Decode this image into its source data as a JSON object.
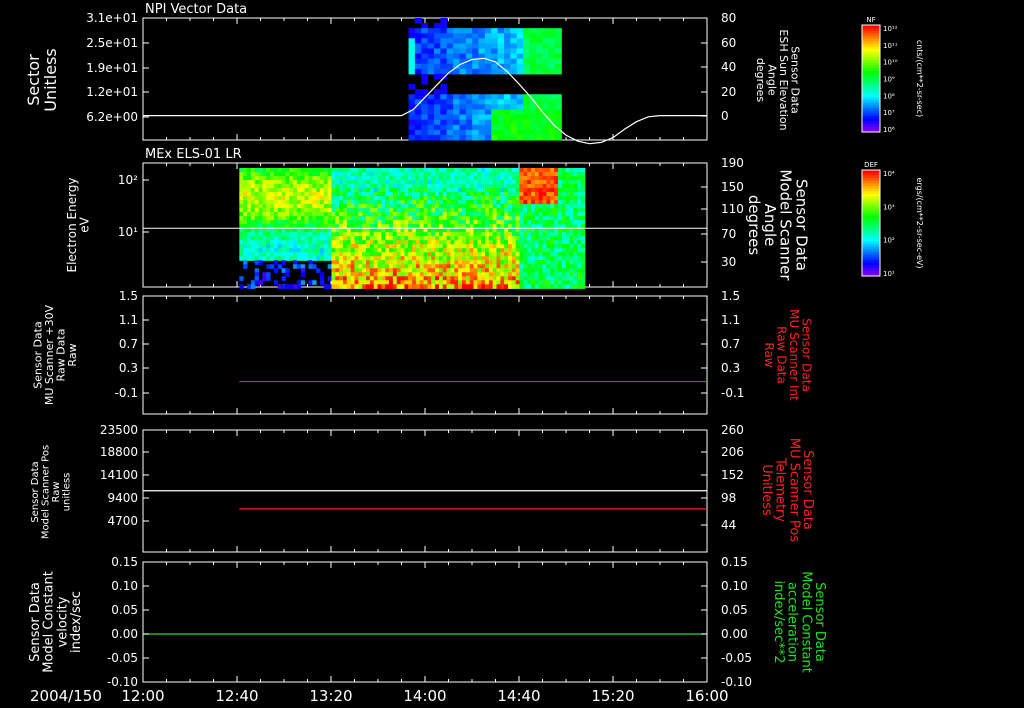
{
  "footer": {
    "date_label": "2004/150"
  },
  "time_axis": {
    "ticks": [
      "12:00",
      "12:40",
      "13:20",
      "14:00",
      "14:40",
      "15:20",
      "16:00"
    ],
    "tick_minutes": [
      0,
      40,
      80,
      120,
      160,
      200,
      240
    ]
  },
  "colorbars": [
    {
      "tag": "NF",
      "unit": "cnts/(cm**2-sr-sec)",
      "labels": [
        "10¹²",
        "10¹¹",
        "10¹⁰",
        "10⁹",
        "10⁸",
        "10⁷",
        "10⁶"
      ]
    },
    {
      "tag": "DEF",
      "unit": "ergs/(cm**2-sr-sec-eV)",
      "labels": [
        "10⁴",
        "10³",
        "10²",
        "10¹"
      ]
    }
  ],
  "chart_data": [
    {
      "type": "heatmap",
      "title": "NPI Vector Data",
      "ylabel": [
        "Sector",
        "Unitless"
      ],
      "y_ticks": [
        "3.1e+01",
        "2.5e+01",
        "1.9e+01",
        "1.2e+01",
        "6.2e+00"
      ],
      "y2label": [
        "Sensor Data",
        "ESH Sun Elevation",
        "Angle",
        "degrees"
      ],
      "y2_ticks": [
        "80",
        "60",
        "40",
        "20",
        "0"
      ],
      "y2_range": [
        -20,
        80
      ],
      "data_range_minutes": [
        113,
        178
      ],
      "overlay_line": {
        "name": "ESH Sun Elevation Angle",
        "x_minutes": [
          0,
          110,
          115,
          120,
          125,
          130,
          135,
          140,
          145,
          150,
          155,
          160,
          165,
          170,
          175,
          180,
          185,
          190,
          195,
          200,
          205,
          210,
          215,
          220,
          225,
          240
        ],
        "y": [
          0,
          0,
          5,
          15,
          25,
          35,
          42,
          46,
          47,
          44,
          36,
          26,
          15,
          3,
          -8,
          -16,
          -21,
          -23,
          -22,
          -18,
          -11,
          -5,
          -1,
          0,
          0,
          0
        ]
      }
    },
    {
      "type": "heatmap",
      "title": "MEx ELS-01 LR",
      "ylabel": [
        "Electron Energy",
        "eV"
      ],
      "y_ticks": [
        "10²",
        "10¹"
      ],
      "y2label": [
        "Sensor Data",
        "Model Scanner",
        "Angle",
        "degrees"
      ],
      "y2_ticks": [
        "190",
        "150",
        "110",
        "70",
        "30"
      ],
      "y2_range": [
        0,
        190
      ],
      "data_range_minutes": [
        41,
        188
      ],
      "overlay_line": {
        "name": "Model Scanner Angle",
        "value": 90
      }
    },
    {
      "type": "line",
      "ylabel": [
        "Sensor Data",
        "MU Scanner +30V",
        "Raw Data",
        "Raw"
      ],
      "y_ticks": [
        "1.5",
        "1.1",
        "0.7",
        "0.3",
        "-0.1"
      ],
      "ylim": [
        -0.5,
        1.5
      ],
      "y2label": [
        "Sensor Data",
        "MU Scanner Int",
        "Raw Data",
        "Raw"
      ],
      "y2_ticks": [
        "1.5",
        "1.1",
        "0.7",
        "0.3",
        "-0.1"
      ],
      "series": [
        {
          "color": "#ff2020",
          "x_minutes": [
            41,
            240
          ],
          "y": [
            0.05,
            0.05
          ]
        }
      ]
    },
    {
      "type": "line",
      "ylabel": [
        "Sensor Data",
        "Model Scanner Pos",
        "Raw",
        "unitless"
      ],
      "y_ticks": [
        "23500",
        "18800",
        "14100",
        "9400",
        "4700"
      ],
      "ylim": [
        0,
        23500
      ],
      "y2label": [
        "Sensor Data",
        "MU Scanner Pos",
        "Telemetry",
        "Unitless"
      ],
      "y2_ticks": [
        "260",
        "206",
        "152",
        "98",
        "44"
      ],
      "series": [
        {
          "color": "#ffffff",
          "x_minutes": [
            0,
            240
          ],
          "y": [
            11800,
            11800
          ]
        },
        {
          "color": "#ff2020",
          "x_minutes": [
            41,
            240
          ],
          "y": [
            8300,
            8300
          ]
        }
      ]
    },
    {
      "type": "line",
      "ylabel": [
        "Sensor Data",
        "Model Constant",
        "velocity",
        "index/sec"
      ],
      "y_ticks": [
        "0.15",
        "0.10",
        "0.05",
        "0.00",
        "-0.05",
        "-0.10"
      ],
      "ylim": [
        -0.1,
        0.15
      ],
      "y2label": [
        "Sensor Data",
        "Model Constant",
        "acceleration",
        "index/sec**2"
      ],
      "y2_ticks": [
        "0.15",
        "0.10",
        "0.05",
        "0.00",
        "-0.05",
        "-0.10"
      ],
      "series": [
        {
          "color": "#20e020",
          "x_minutes": [
            0,
            240
          ],
          "y": [
            0.0,
            0.0
          ]
        }
      ]
    }
  ]
}
